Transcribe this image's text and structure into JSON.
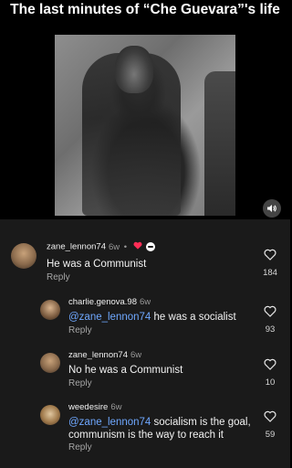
{
  "video": {
    "title": "The last minutes of “Che Guevara”'s life",
    "sound_icon": "speaker-icon"
  },
  "comments": [
    {
      "username": "zane_lennon74",
      "time": "6w",
      "separator": "•",
      "badges": [
        "heart-icon",
        "creator-badge-icon"
      ],
      "text": "He was a Communist",
      "reply_label": "Reply",
      "likes": "184"
    },
    {
      "username": "charlie.genova.98",
      "time": "6w",
      "mention": "@zane_lennon74",
      "text": " he was a socialist",
      "reply_label": "Reply",
      "likes": "93"
    },
    {
      "username": "zane_lennon74",
      "time": "6w",
      "text": "No he was a Communist",
      "reply_label": "Reply",
      "likes": "10"
    },
    {
      "username": "weedesire",
      "time": "6w",
      "mention": "@zane_lennon74",
      "text": " socialism is the goal, communism is the way to reach it",
      "reply_label": "Reply",
      "likes": "59"
    }
  ],
  "colors": {
    "background": "#1a1a1a",
    "mention": "#6fa8ff",
    "heart": "#ff2d55"
  }
}
